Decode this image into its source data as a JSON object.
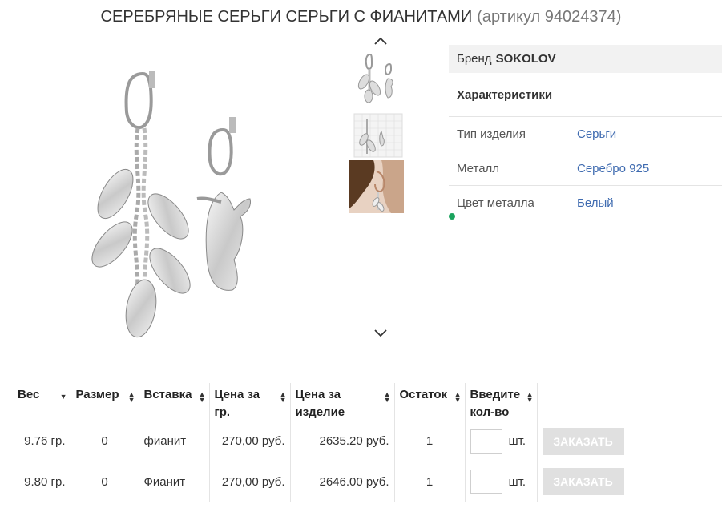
{
  "product": {
    "title": "СЕРЕБРЯНЫЕ СЕРЬГИ СЕРЬГИ С ФИАНИТАМИ",
    "article": "(артикул 94024374)"
  },
  "specs": {
    "brand_label": "Бренд",
    "brand_value": "SOKOLOV",
    "section_title": "Характеристики",
    "rows": [
      {
        "key": "Тип изделия",
        "value": "Серьги"
      },
      {
        "key": "Металл",
        "value": "Серебро 925"
      },
      {
        "key": "Цвет металла",
        "value": "Белый"
      }
    ]
  },
  "table": {
    "headers": [
      "Вес",
      "Размер",
      "Вставка",
      "Цена за гр.",
      "Цена за изделие",
      "Остаток",
      "Введите кол-во"
    ],
    "rows": [
      {
        "weight": "9.76 гр.",
        "size": "0",
        "insert": "фианит",
        "price_gram": "270,00 руб.",
        "price_item": "2635.20 руб.",
        "stock": "1",
        "qty": "",
        "unit": "шт.",
        "button": "ЗАКАЗАТЬ"
      },
      {
        "weight": "9.80 гр.",
        "size": "0",
        "insert": "Фианит",
        "price_gram": "270,00 руб.",
        "price_item": "2646.00 руб.",
        "stock": "1",
        "qty": "",
        "unit": "шт.",
        "button": "ЗАКАЗАТЬ"
      }
    ]
  },
  "colors": {
    "link": "#3f6bb0",
    "button_disabled": "#e0e0e0",
    "indicator": "#1aa35d"
  },
  "icons": [
    "chevron-up-icon",
    "chevron-down-icon",
    "sort-icon"
  ]
}
